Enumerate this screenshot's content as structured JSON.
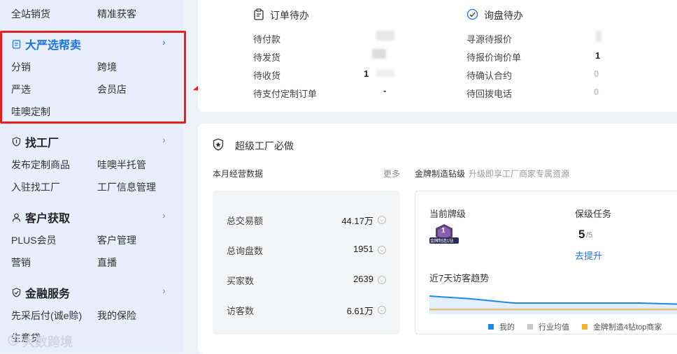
{
  "sidebar": {
    "top_row": [
      "全站销货",
      "精准获客"
    ],
    "groups": [
      {
        "title": "大严选帮卖",
        "icon": "document-icon",
        "items": [
          "分销",
          "跨境",
          "严选",
          "会员店",
          "哇噢定制"
        ]
      },
      {
        "title": "找工厂",
        "icon": "shield-icon",
        "items": [
          "发布定制商品",
          "哇噢半托管",
          "入驻找工厂",
          "工厂信息管理"
        ]
      },
      {
        "title": "客户获取",
        "icon": "user-icon",
        "items": [
          "PLUS会员",
          "客户管理",
          "营销",
          "直播"
        ]
      },
      {
        "title": "金融服务",
        "icon": "shield-check-icon",
        "items": [
          "先采后付(诚e赊)",
          "我的保险",
          "生意贷"
        ]
      }
    ],
    "watermark": "大数跨境"
  },
  "orders": {
    "title": "订单待办",
    "items": [
      {
        "label": "待付款",
        "value": ""
      },
      {
        "label": "待发货",
        "value": ""
      },
      {
        "label": "待收货",
        "value": "1"
      },
      {
        "label": "待支付定制订单",
        "value": "-"
      }
    ]
  },
  "inquiry": {
    "title": "询盘待办",
    "items": [
      {
        "label": "寻源待报价",
        "value": ""
      },
      {
        "label": "待报价询价单",
        "value": "1"
      },
      {
        "label": "待确认合约",
        "value": "0"
      },
      {
        "label": "待回拨电话",
        "value": "0"
      }
    ]
  },
  "factory": {
    "title": "超级工厂必做",
    "monthly_title": "本月经营数据",
    "more": "更多",
    "stats": [
      {
        "label": "总交易额",
        "value": "44.17万"
      },
      {
        "label": "总询盘数",
        "value": "1951"
      },
      {
        "label": "买家数",
        "value": "2639"
      },
      {
        "label": "访客数",
        "value": "6.61万"
      }
    ],
    "gold_title": "金牌制造钻级",
    "gold_subtitle": "升级即享工厂商家专属资源",
    "current_level_label": "当前牌级",
    "badge_text": "金牌制造1钻",
    "badge_num": "1",
    "task_label": "保级任务",
    "task_value": "5",
    "task_total": "/5",
    "improve": "去提升",
    "trend_title": "近7天访客趋势",
    "legend": [
      {
        "name": "我的",
        "color": "#1e88e5"
      },
      {
        "name": "行业均值",
        "color": "#c8c8c8"
      },
      {
        "name": "金牌制造4钻top商家",
        "color": "#f0b429"
      }
    ]
  }
}
